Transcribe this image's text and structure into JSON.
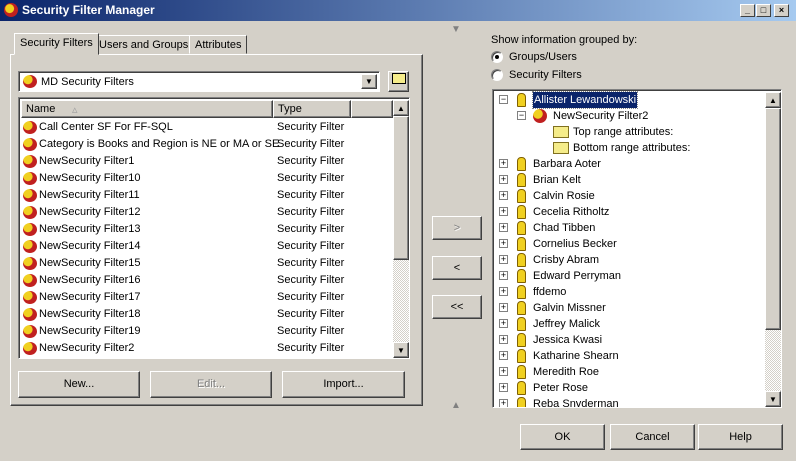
{
  "window": {
    "title": "Security Filter Manager"
  },
  "tabs": [
    "Security Filters",
    "Users and Groups",
    "Attributes"
  ],
  "combo": {
    "value": "MD Security Filters"
  },
  "list": {
    "columns": [
      "Name",
      "Type"
    ],
    "rows": [
      {
        "name": "Call Center SF For FF-SQL",
        "type": "Security Filter"
      },
      {
        "name": "Category is Books and Region is NE or MA or SE",
        "type": "Security Filter"
      },
      {
        "name": "NewSecurity Filter1",
        "type": "Security Filter"
      },
      {
        "name": "NewSecurity Filter10",
        "type": "Security Filter"
      },
      {
        "name": "NewSecurity Filter11",
        "type": "Security Filter"
      },
      {
        "name": "NewSecurity Filter12",
        "type": "Security Filter"
      },
      {
        "name": "NewSecurity Filter13",
        "type": "Security Filter"
      },
      {
        "name": "NewSecurity Filter14",
        "type": "Security Filter"
      },
      {
        "name": "NewSecurity Filter15",
        "type": "Security Filter"
      },
      {
        "name": "NewSecurity Filter16",
        "type": "Security Filter"
      },
      {
        "name": "NewSecurity Filter17",
        "type": "Security Filter"
      },
      {
        "name": "NewSecurity Filter18",
        "type": "Security Filter"
      },
      {
        "name": "NewSecurity Filter19",
        "type": "Security Filter"
      },
      {
        "name": "NewSecurity Filter2",
        "type": "Security Filter"
      }
    ]
  },
  "buttons": {
    "new": "New...",
    "edit": "Edit...",
    "import": "Import...",
    "add": ">",
    "remove": "<",
    "remove_all": "<<",
    "ok": "OK",
    "cancel": "Cancel",
    "help": "Help"
  },
  "group": {
    "label": "Show information grouped by:",
    "options": [
      "Groups/Users",
      "Security Filters"
    ],
    "selected": "Groups/Users"
  },
  "tree": {
    "root": "Allister Lewandowski",
    "filter": "NewSecurity Filter2",
    "top": "Top range attributes:",
    "bottom": "Bottom range attributes:",
    "users": [
      "Barbara Aoter",
      "Brian Kelt",
      "Calvin Rosie",
      "Cecelia Ritholtz",
      "Chad Tibben",
      "Cornelius Becker",
      "Crisby Abram",
      "Edward Perryman",
      "ffdemo",
      "Galvin Missner",
      "Jeffrey Malick",
      "Jessica Kwasi",
      "Katharine Shearn",
      "Meredith Roe",
      "Peter Rose",
      "Reba Snyderman"
    ]
  }
}
